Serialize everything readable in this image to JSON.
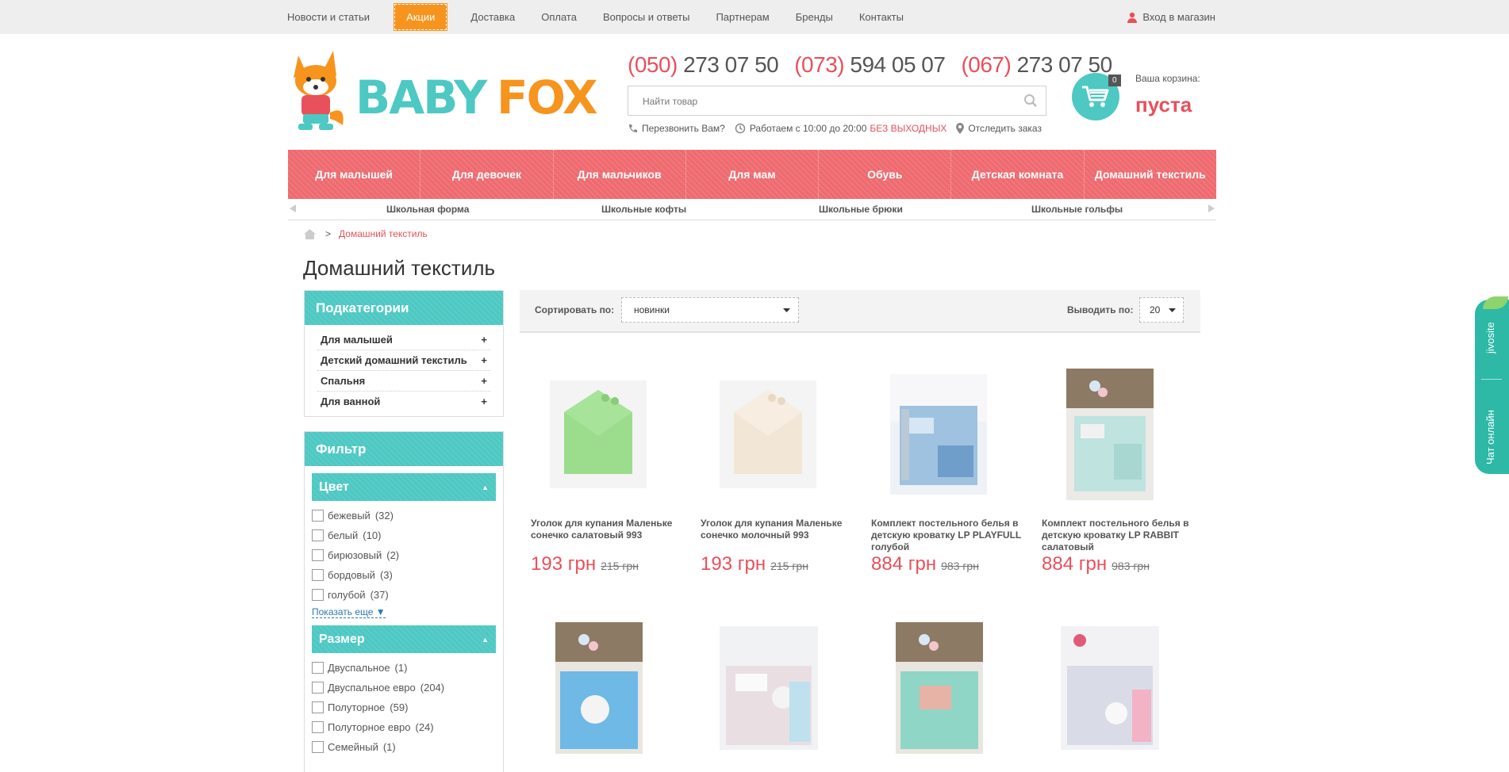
{
  "topnav": {
    "items": [
      "Новости и статьи",
      "Акции",
      "Доставка",
      "Оплата",
      "Вопросы и ответы",
      "Партнерам",
      "Бренды",
      "Контакты"
    ],
    "login": "Вход в магазин"
  },
  "header": {
    "logo_text_1": "BABY",
    "logo_text_2": "FOX",
    "phones": [
      {
        "code": "(050)",
        "number": " 273 07 50"
      },
      {
        "code": "(073)",
        "number": " 594 05 07"
      },
      {
        "code": "(067)",
        "number": " 273 07 50"
      }
    ],
    "search_placeholder": "Найти товар",
    "callback": "Перезвонить Вам?",
    "hours": "Работаем с 10:00 до 20:00",
    "hours_highlight": "БЕЗ ВЫХОДНЫХ",
    "track": "Отследить заказ",
    "cart_label": "Ваша корзина:",
    "cart_state": "пуста",
    "cart_count": "0"
  },
  "mainnav": [
    "Для малышей",
    "Для девочек",
    "Для мальчиков",
    "Для мам",
    "Обувь",
    "Детская комната",
    "Домашний текстиль"
  ],
  "subnav": [
    "Школьная форма",
    "Школьные кофты",
    "Школьные брюки",
    "Школьные гольфы"
  ],
  "breadcrumb": {
    "sep": ">",
    "current": "Домашний текстиль"
  },
  "page_title": "Домашний текстиль",
  "subcategories": {
    "title": "Подкатегории",
    "items": [
      "Для малышей",
      "Детский домашний текстиль",
      "Спальня",
      "Для ванной"
    ],
    "expand": "+"
  },
  "filter": {
    "title": "Фильтр",
    "color": {
      "title": "Цвет",
      "options": [
        {
          "label": "бежевый",
          "count": "(32)"
        },
        {
          "label": "белый",
          "count": "(10)"
        },
        {
          "label": "бирюзовый",
          "count": "(2)"
        },
        {
          "label": "бордовый",
          "count": "(3)"
        },
        {
          "label": "голубой",
          "count": "(37)"
        }
      ],
      "more": "Показать еще ▼"
    },
    "size": {
      "title": "Размер",
      "options": [
        {
          "label": "Двуспальное",
          "count": "(1)"
        },
        {
          "label": "Двуспальное евро",
          "count": "(204)"
        },
        {
          "label": "Полуторное",
          "count": "(59)"
        },
        {
          "label": "Полуторное евро",
          "count": "(24)"
        },
        {
          "label": "Семейный",
          "count": "(1)"
        }
      ]
    }
  },
  "sortbar": {
    "sort_label": "Сортировать по:",
    "sort_value": "новинки",
    "per_label": "Выводить по:",
    "per_value": "20"
  },
  "products": [
    {
      "name": "Уголок для купания Маленьке сонечко салатовый 993",
      "price": "193 грн",
      "old_price": "215 грн",
      "color": "#9bdc8d"
    },
    {
      "name": "Уголок для купания Маленьке сонечко молочный 993",
      "price": "193 грн",
      "old_price": "215 грн",
      "color": "#f2e6d6"
    },
    {
      "name": "Комплект постельного белья в детскую кроватку LP PLAYFULL голубой",
      "price": "884 грн",
      "old_price": "983 грн",
      "color": "#9fc2e0"
    },
    {
      "name": "Комплект постельного белья в детскую кроватку LP RABBIT салатовый",
      "price": "884 грн",
      "old_price": "983 грн",
      "color": "#bfe3df"
    },
    {
      "name": "",
      "price": "",
      "old_price": "",
      "color": "#6fb9e6"
    },
    {
      "name": "",
      "price": "",
      "old_price": "",
      "color": "#e9dfe3"
    },
    {
      "name": "",
      "price": "",
      "old_price": "",
      "color": "#8fd6c6"
    },
    {
      "name": "",
      "price": "",
      "old_price": "",
      "color": "#d9dce6"
    }
  ],
  "chat": {
    "brand": "jivosite",
    "label": "Чат онлайн"
  },
  "colors": {
    "teal": "#4dc8c3",
    "coral": "#ee6a6f",
    "orange": "#f7941d",
    "price_red": "#e8505b"
  }
}
